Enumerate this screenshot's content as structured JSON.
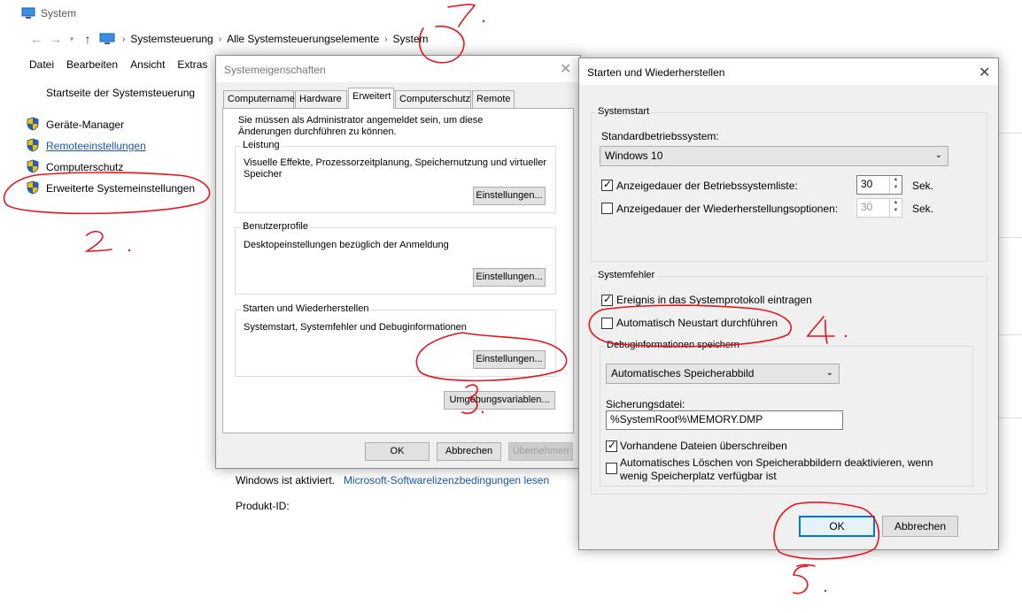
{
  "window": {
    "title": "System"
  },
  "address": {
    "crumbs": [
      "Systemsteuerung",
      "Alle Systemsteuerungselemente",
      "System"
    ]
  },
  "menu": {
    "items": [
      "Datei",
      "Bearbeiten",
      "Ansicht",
      "Extras"
    ]
  },
  "sidebar": {
    "home": "Startseite der Systemsteuerung",
    "items": [
      {
        "label": "Geräte-Manager"
      },
      {
        "label": "Remoteeinstellungen"
      },
      {
        "label": "Computerschutz"
      },
      {
        "label": "Erweiterte Systemeinstellungen"
      }
    ]
  },
  "main": {
    "activation_status": "Windows ist aktiviert.",
    "license_link": "Microsoft-Softwarelizenzbedingungen lesen",
    "product_id_label": "Produkt-ID:"
  },
  "sysprops": {
    "title": "Systemeigenschaften",
    "tabs": [
      "Computername",
      "Hardware",
      "Erweitert",
      "Computerschutz",
      "Remote"
    ],
    "admin_note": "Sie müssen als Administrator angemeldet sein, um diese Änderungen durchführen zu können.",
    "perf": {
      "label": "Leistung",
      "desc": "Visuelle Effekte, Prozessorzeitplanung, Speichernutzung und virtueller Speicher",
      "button": "Einstellungen..."
    },
    "profiles": {
      "label": "Benutzerprofile",
      "desc": "Desktopeinstellungen bezüglich der Anmeldung",
      "button": "Einstellungen..."
    },
    "startup": {
      "label": "Starten und Wiederherstellen",
      "desc": "Systemstart, Systemfehler und Debuginformationen",
      "button": "Einstellungen..."
    },
    "env_button": "Umgebungsvariablen...",
    "ok": "OK",
    "cancel": "Abbrechen",
    "apply": "Übernehmen"
  },
  "startrecovery": {
    "title": "Starten und Wiederherstellen",
    "systemstart": {
      "label": "Systemstart",
      "default_os_label": "Standardbetriebssystem:",
      "default_os_value": "Windows 10",
      "show_list_label": "Anzeigedauer der Betriebssystemliste:",
      "show_list_value": "30",
      "show_recovery_label": "Anzeigedauer der Wiederherstellungsoptionen:",
      "show_recovery_value": "30",
      "unit": "Sek."
    },
    "systemerror": {
      "label": "Systemfehler",
      "log_event": "Ereignis in das Systemprotokoll eintragen",
      "auto_restart": "Automatisch Neustart durchführen",
      "debug_label": "Debuginformationen speichern",
      "debug_value": "Automatisches Speicherabbild",
      "dump_file_label": "Sicherungsdatei:",
      "dump_file_value": "%SystemRoot%\\MEMORY.DMP",
      "overwrite": "Vorhandene Dateien überschreiben",
      "disable_auto_delete": "Automatisches Löschen von Speicherabbildern deaktivieren, wenn wenig Speicherplatz verfügbar ist"
    },
    "ok": "OK",
    "cancel": "Abbrechen"
  },
  "annotations": {
    "marks": [
      "1.",
      "2.",
      "3.",
      "4.",
      "5."
    ]
  },
  "colors": {
    "annotation": "#e8141b",
    "accent": "#0078d7",
    "link": "#1a56a8"
  }
}
